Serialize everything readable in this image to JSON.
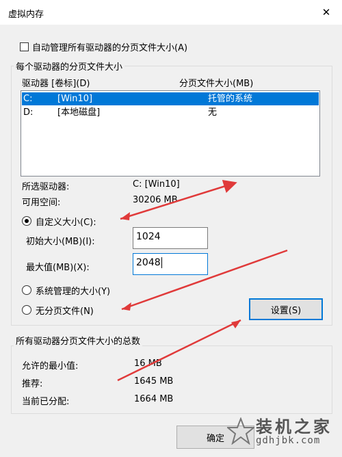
{
  "window": {
    "title": "虚拟内存",
    "close_glyph": "✕"
  },
  "auto_manage": {
    "label": "自动管理所有驱动器的分页文件大小(A)",
    "checked": false
  },
  "drives_group": {
    "title": "每个驱动器的分页文件大小",
    "col_drive": "驱动器 [卷标](D)",
    "col_paging": "分页文件大小(MB)",
    "rows": [
      {
        "letter": "C:",
        "label": "[Win10]",
        "size": "托管的系统",
        "selected": true
      },
      {
        "letter": "D:",
        "label": "[本地磁盘]",
        "size": "无",
        "selected": false
      }
    ]
  },
  "selected_drive": {
    "drive_label": "所选驱动器:",
    "drive_value": "C:  [Win10]",
    "space_label": "可用空间:",
    "space_value": "30206 MB"
  },
  "options": {
    "custom_label": "自定义大小(C):",
    "initial_label": "初始大小(MB)(I):",
    "initial_value": "1024",
    "max_label": "最大值(MB)(X):",
    "max_value": "2048",
    "system_label": "系统管理的大小(Y)",
    "none_label": "无分页文件(N)",
    "selected": "custom",
    "set_button": "设置(S)"
  },
  "totals_group": {
    "title": "所有驱动器分页文件大小的总数",
    "min_label": "允许的最小值:",
    "min_value": "16 MB",
    "rec_label": "推荐:",
    "rec_value": "1645 MB",
    "cur_label": "当前已分配:",
    "cur_value": "1664 MB"
  },
  "footer": {
    "ok_button": "确定"
  },
  "watermark": {
    "main": "装机之家",
    "sub": "gdhjbk.com"
  },
  "colors": {
    "selection": "#0078d7",
    "annotation_arrow": "#e03a3a",
    "dialog_bg": "#f0f0f0"
  }
}
